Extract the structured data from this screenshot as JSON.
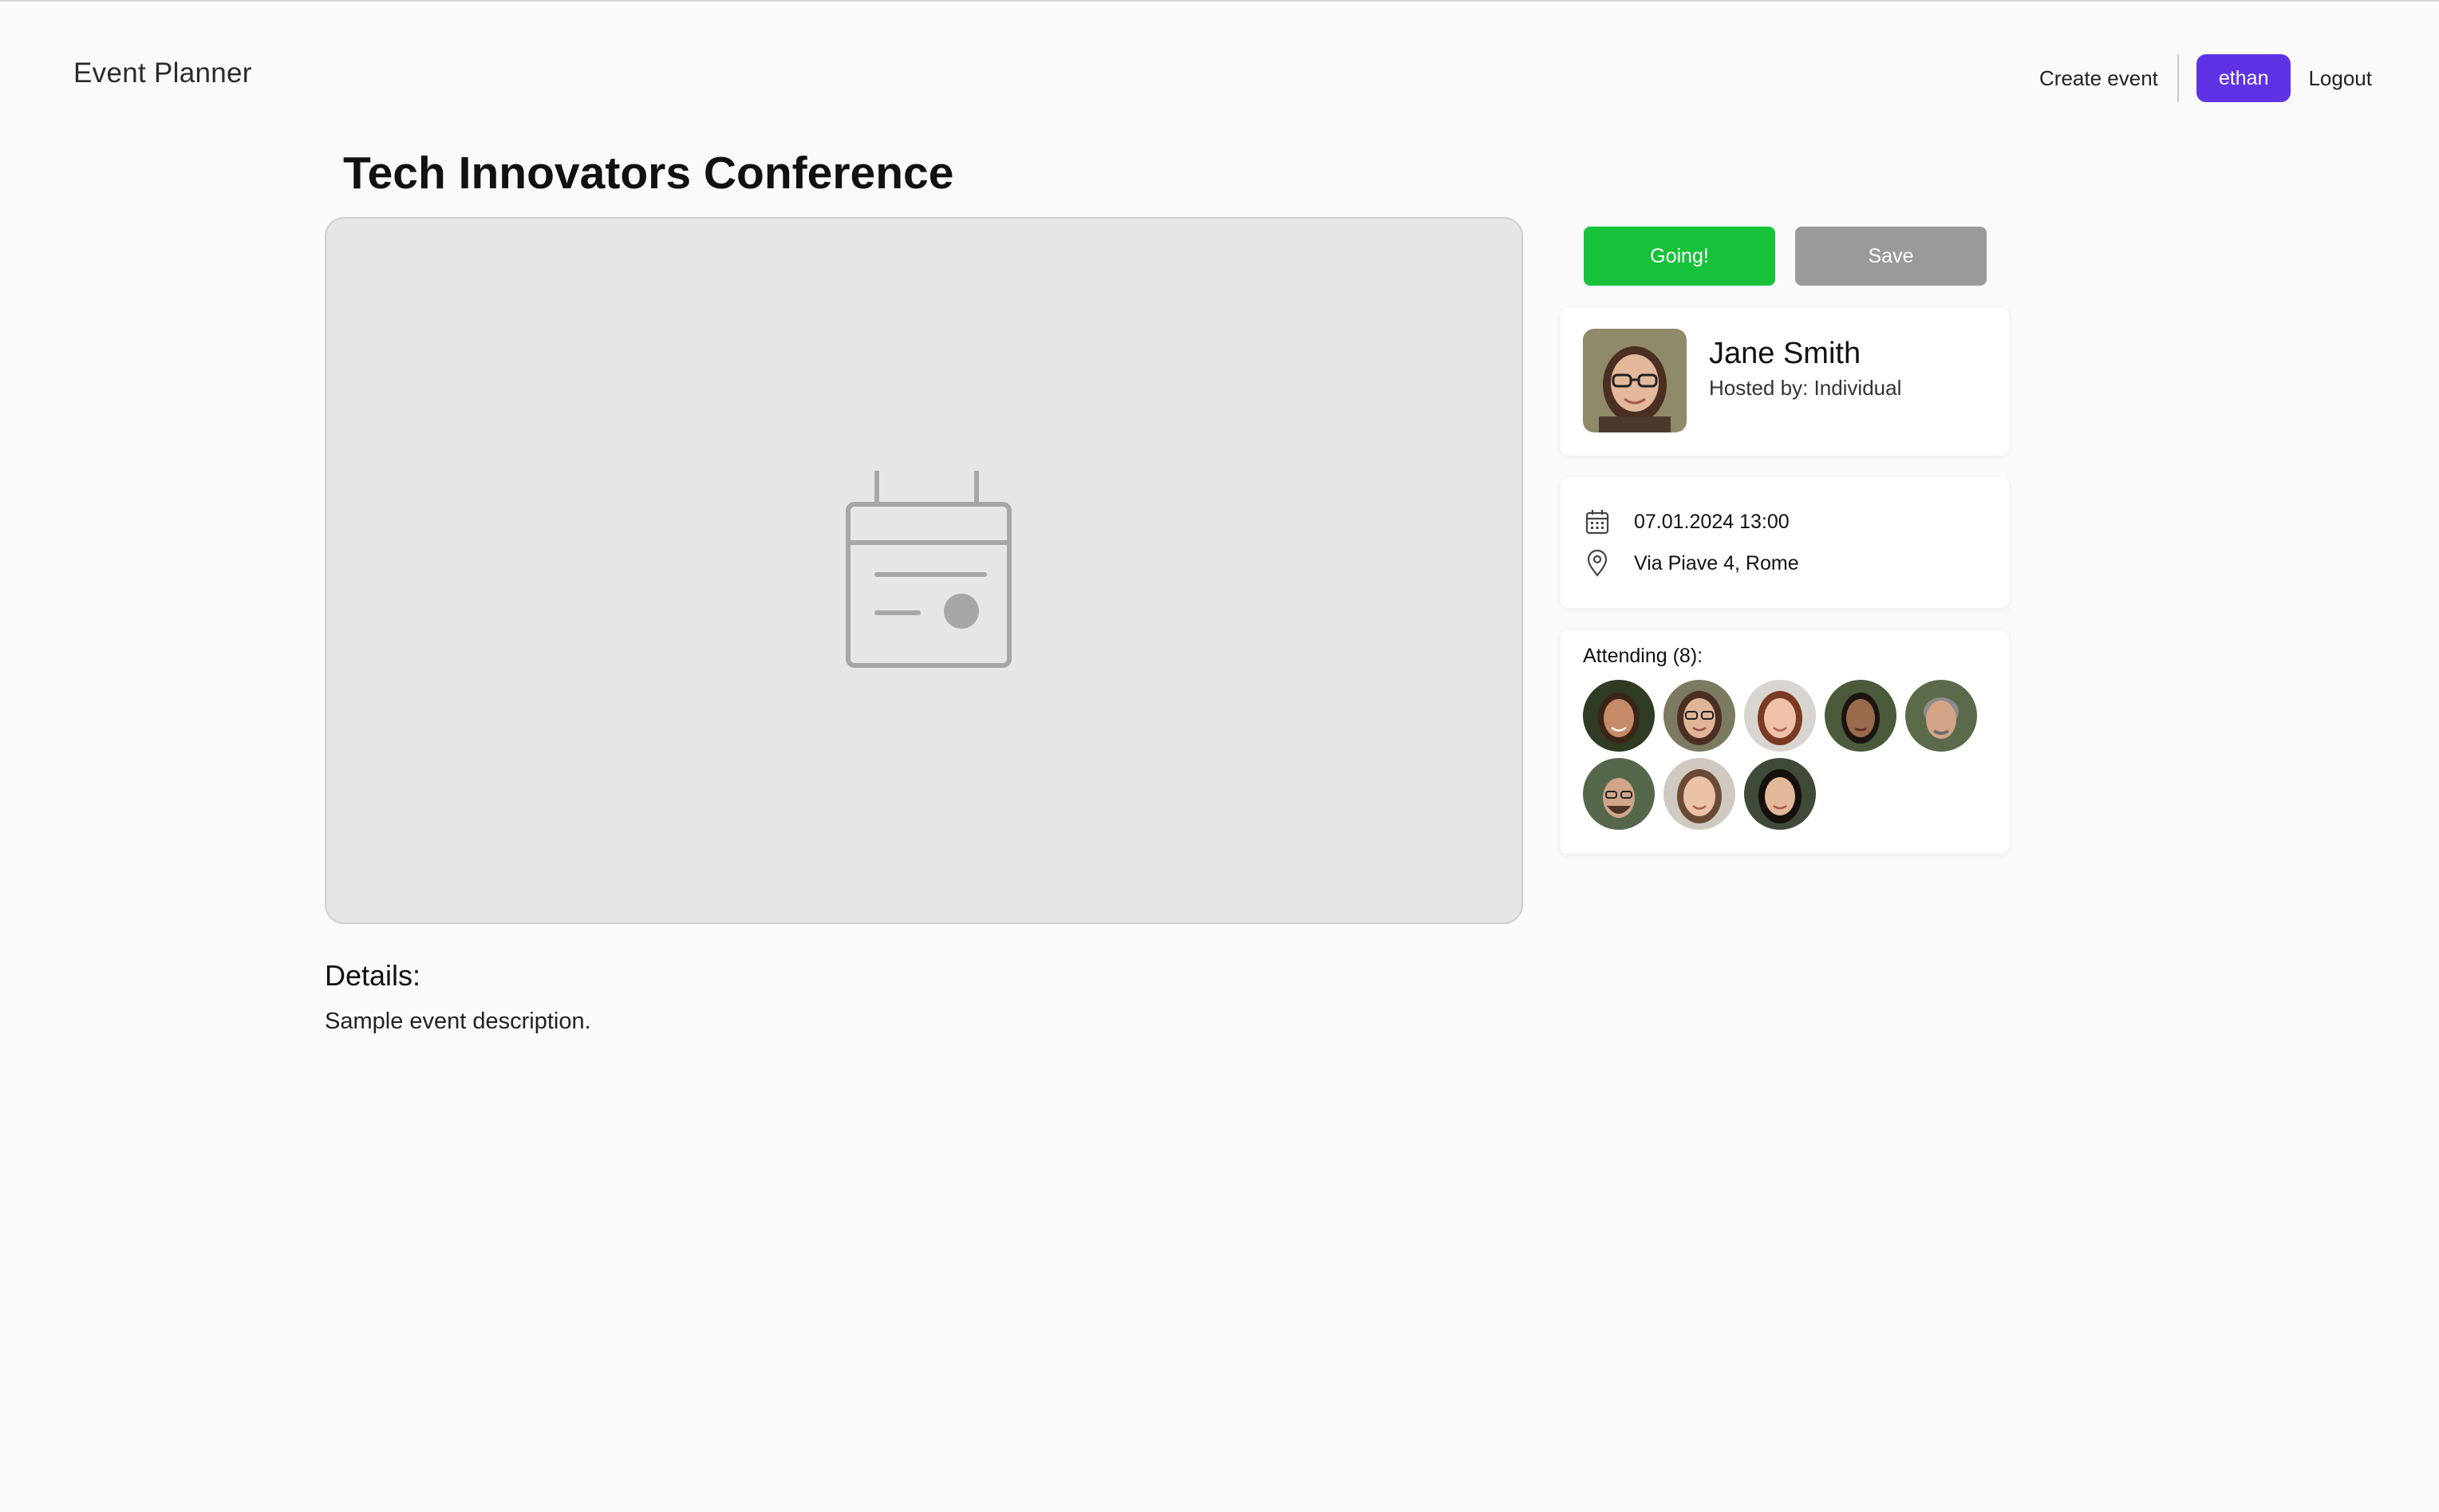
{
  "header": {
    "brand": "Event Planner",
    "create_event": "Create event",
    "user": "ethan",
    "logout": "Logout"
  },
  "event": {
    "title": "Tech Innovators Conference",
    "image_icon": "calendar-placeholder-icon",
    "details_heading": "Details:",
    "description": "Sample event description."
  },
  "actions": {
    "going_label": "Going!",
    "save_label": "Save",
    "going_color": "#17c23a",
    "save_color": "#9a9a9a"
  },
  "host": {
    "name": "Jane Smith",
    "hosted_by": "Hosted by: Individual"
  },
  "info": {
    "datetime": "07.01.2024 13:00",
    "location": "Via Piave 4, Rome",
    "date_icon": "calendar-icon",
    "location_icon": "map-pin-icon"
  },
  "attendees": {
    "label": "Attending (8):",
    "count": 8
  },
  "colors": {
    "accent": "#5f32e6",
    "background": "#fafafc"
  }
}
